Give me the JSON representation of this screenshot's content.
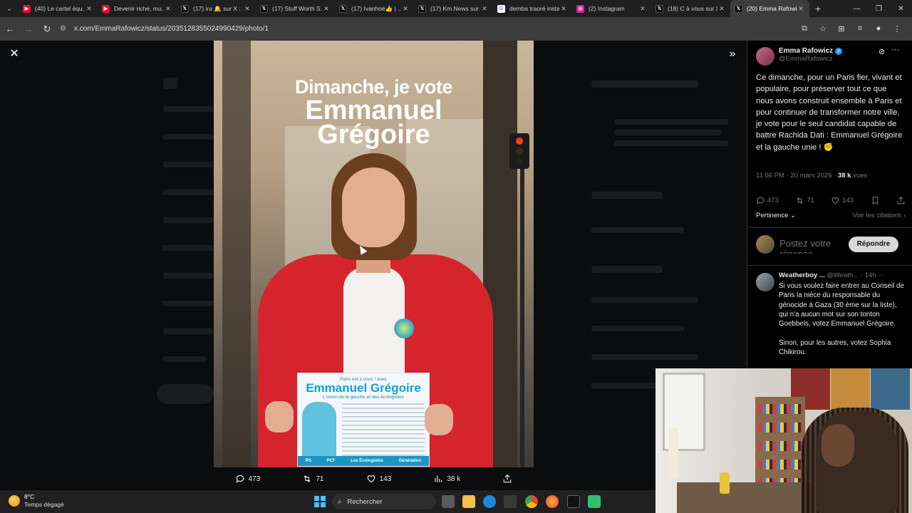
{
  "browser": {
    "tabs": [
      {
        "title": "(40) Le cartel équ...",
        "icon": "youtube-icon",
        "color": "#ff0033",
        "active": false
      },
      {
        "title": "Devenir riche, mu...",
        "icon": "youtube-icon",
        "color": "#ff0033",
        "active": false
      },
      {
        "title": "(17) ira 🔔 sur X :",
        "icon": "x-icon",
        "color": "#000000",
        "active": false
      },
      {
        "title": "(17) Stuff Worth S...",
        "icon": "x-icon",
        "color": "#000000",
        "active": false
      },
      {
        "title": "(17) Ivanhoé👍 | ...",
        "icon": "x-icon",
        "color": "#000000",
        "active": false
      },
      {
        "title": "(17) Km.News sur ...",
        "icon": "x-icon",
        "color": "#000000",
        "active": false
      },
      {
        "title": "demba traoré insta...",
        "icon": "google-icon",
        "color": "#ffffff",
        "active": false
      },
      {
        "title": "(2) Instagram",
        "icon": "instagram-icon",
        "color": "#d6249f",
        "active": false
      },
      {
        "title": "(18) C à vous sur X",
        "icon": "x-icon",
        "color": "#000000",
        "active": false
      },
      {
        "title": "(20) Emma Rafowi...",
        "icon": "x-icon",
        "color": "#000000",
        "active": true
      }
    ],
    "url": "x.com/EmmaRafowicz/status/2035128355024990429/photo/1"
  },
  "photo": {
    "title_line1": "Dimanche, je vote",
    "title_line2": "Emmanuel",
    "title_line3": "Grégoire",
    "tract_top": "Paris est à vous ! avec",
    "tract_name": "Emmanuel Grégoire",
    "tract_sub": "L'union de la gauche et des écologistes",
    "tract_footer": [
      "PS",
      "PCF",
      "Les Écologistes",
      "Génération"
    ]
  },
  "photo_actions": {
    "replies": "473",
    "reposts": "71",
    "likes": "143",
    "views": "38 k"
  },
  "tweet": {
    "author_name": "Emma Rafowicz",
    "author_handle": "@EmmaRafowicz",
    "text": "Ce dimanche, pour un Paris fier, vivant et populaire, pour préserver tout ce que nous avons construit ensemble à Paris et pour continuer de transformer notre ville, je vote pour le seul candidat capable de battre Rachida Dati : Emmanuel Grégoire et la gauche unie ! ✊",
    "time": "11:56 PM · 20 mars 2026 ·",
    "views_count": "38 k",
    "views_label": "vues",
    "stats": {
      "replies": "473",
      "reposts": "71",
      "likes": "143"
    },
    "sort_label": "Pertinence",
    "quotes_link": "Voir les citations"
  },
  "reply_composer": {
    "placeholder": "Postez votre réponse",
    "button": "Répondre"
  },
  "reply": {
    "name": "Weatherboy ...",
    "handle": "@Weath...",
    "time": "· 14h",
    "text": "Si vous voulez faire entrer au Conseil de Paris la nièce du responsable du génocide à Gaza (30 ème sur la liste), qui n'a aucun mot sur son tonton Goebbels, votez Emmanuel Grégoire.\n\nSinon, pour les autres, votez Sophia Chikirou."
  },
  "taskbar": {
    "temp": "8°C",
    "condition": "Temps dégagé",
    "search_label": "Rechercher"
  }
}
